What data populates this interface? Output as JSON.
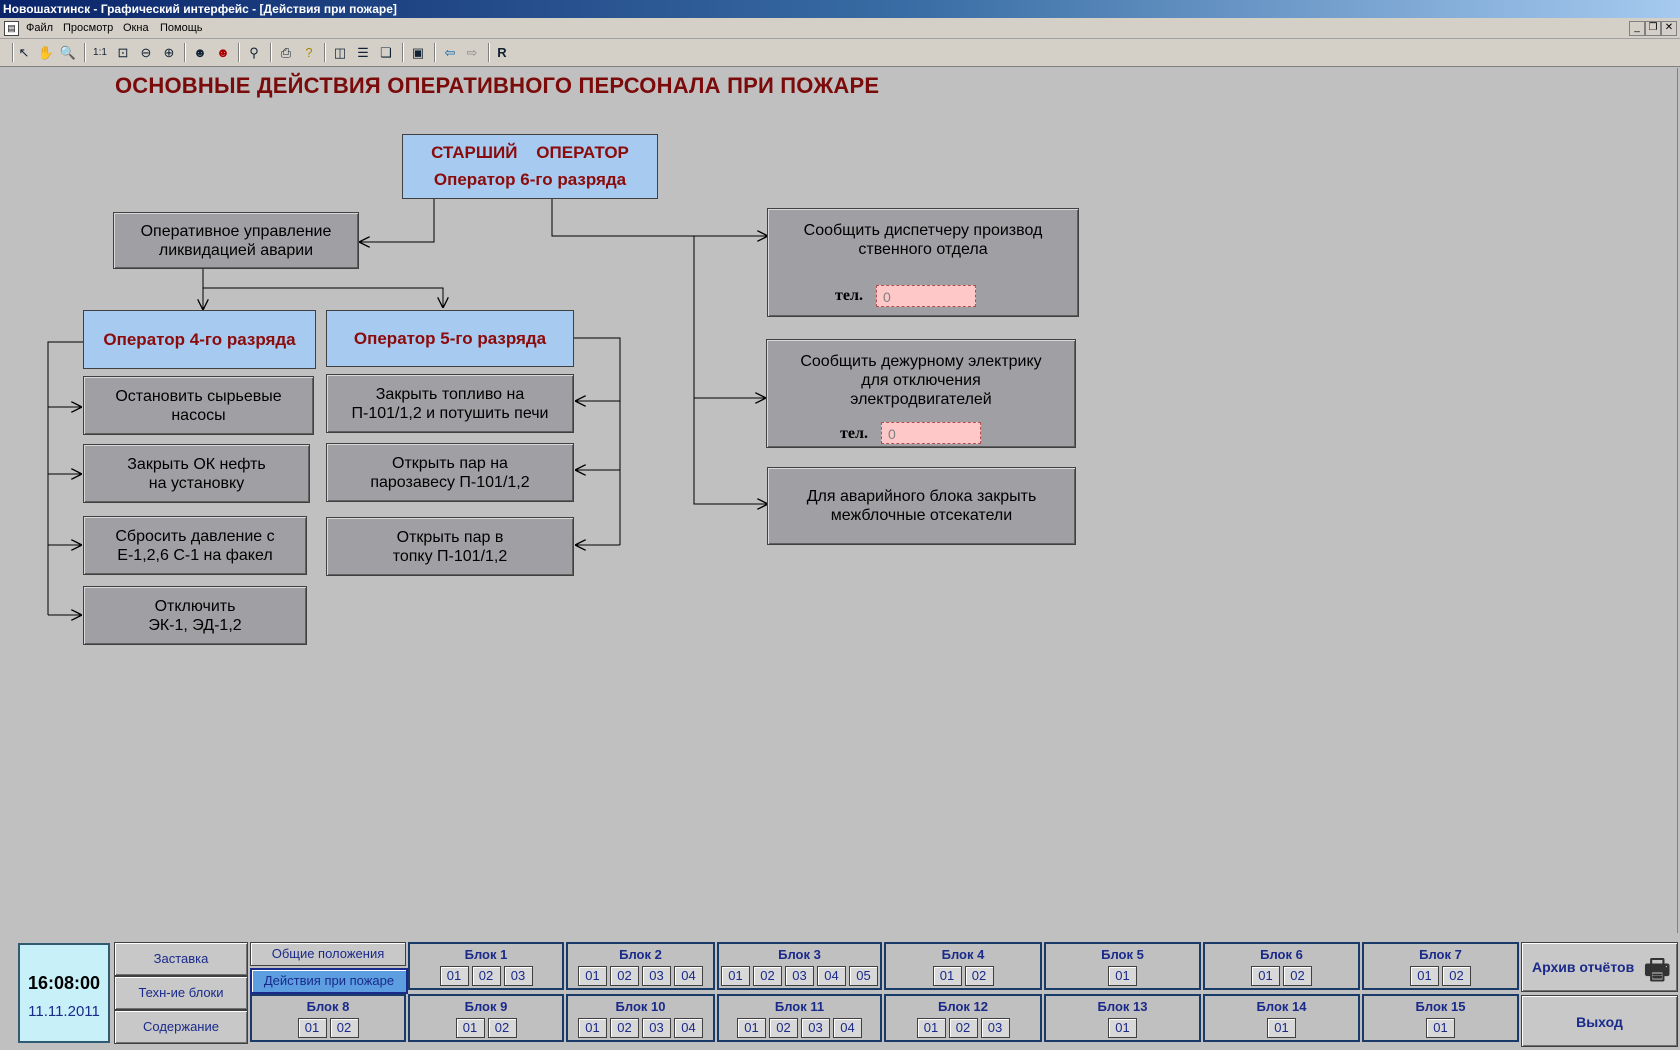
{
  "window": {
    "title": "Новошахтинск - Графический интерфейс - [Действия при пожаре]"
  },
  "menu": {
    "items": [
      "Файл",
      "Просмотр",
      "Окна",
      "Помощь"
    ]
  },
  "toolbar": {
    "r_label": "R"
  },
  "page": {
    "title": "ОСНОВНЫЕ ДЕЙСТВИЯ ОПЕРАТИВНОГО ПЕРСОНАЛА ПРИ ПОЖАРЕ"
  },
  "diagram": {
    "senior": {
      "line1": "СТАРШИЙ    ОПЕРАТОР",
      "line2": "Оператор 6-го разряда"
    },
    "management": "Оперативное управление\nликвидацией аварии",
    "op4": "Оператор 4-го разряда",
    "op5": "Оператор 5-го разряда",
    "op4_tasks": [
      "Остановить сырьевые\nнасосы",
      "Закрыть ОК нефть\nна установку",
      "Сбросить давление с\nЕ-1,2,6 С-1 на факел",
      "Отключить\nЭК-1, ЭД-1,2"
    ],
    "op5_tasks": [
      "Закрыть топливо на\nП-101/1,2 и потушить печи",
      "Открыть пар на\nпарозавесу П-101/1,2",
      "Открыть пар в\nтопку П-101/1,2"
    ],
    "right": {
      "dispatcher": "Сообщить диспетчеру производ\nственного отдела",
      "electrician": "Сообщить дежурному электрику\nдля отключения\nэлектродвигателей",
      "block": "Для аварийного блока  закрыть\nмежблочные отсекатели",
      "phone_label": "тел.",
      "dispatcher_phone": "0",
      "electrician_phone": "0"
    }
  },
  "bottom": {
    "time": "16:08:00",
    "date": "11.11.2011",
    "nav": [
      "Заставка",
      "Техн-ие блоки",
      "Содержание"
    ],
    "sections": {
      "general": "Общие положения",
      "fire": "Действия при пожаре"
    },
    "blocks_row1": [
      {
        "name": "Блок 1",
        "subs": [
          "01",
          "02",
          "03"
        ]
      },
      {
        "name": "Блок 2",
        "subs": [
          "01",
          "02",
          "03",
          "04"
        ]
      },
      {
        "name": "Блок 3",
        "subs": [
          "01",
          "02",
          "03",
          "04",
          "05"
        ]
      },
      {
        "name": "Блок 4",
        "subs": [
          "01",
          "02"
        ]
      },
      {
        "name": "Блок 5",
        "subs": [
          "01"
        ]
      },
      {
        "name": "Блок 6",
        "subs": [
          "01",
          "02"
        ]
      },
      {
        "name": "Блок 7",
        "subs": [
          "01",
          "02"
        ]
      }
    ],
    "blocks_row2": [
      {
        "name": "Блок 8",
        "subs": [
          "01",
          "02"
        ]
      },
      {
        "name": "Блок 9",
        "subs": [
          "01",
          "02"
        ]
      },
      {
        "name": "Блок 10",
        "subs": [
          "01",
          "02",
          "03",
          "04"
        ]
      },
      {
        "name": "Блок 11",
        "subs": [
          "01",
          "02",
          "03",
          "04"
        ]
      },
      {
        "name": "Блок 12",
        "subs": [
          "01",
          "02",
          "03"
        ]
      },
      {
        "name": "Блок 13",
        "subs": [
          "01"
        ]
      },
      {
        "name": "Блок 14",
        "subs": [
          "01"
        ]
      },
      {
        "name": "Блок 15",
        "subs": [
          "01"
        ]
      }
    ],
    "archive": "Архив отчётов",
    "exit": "Выход"
  }
}
